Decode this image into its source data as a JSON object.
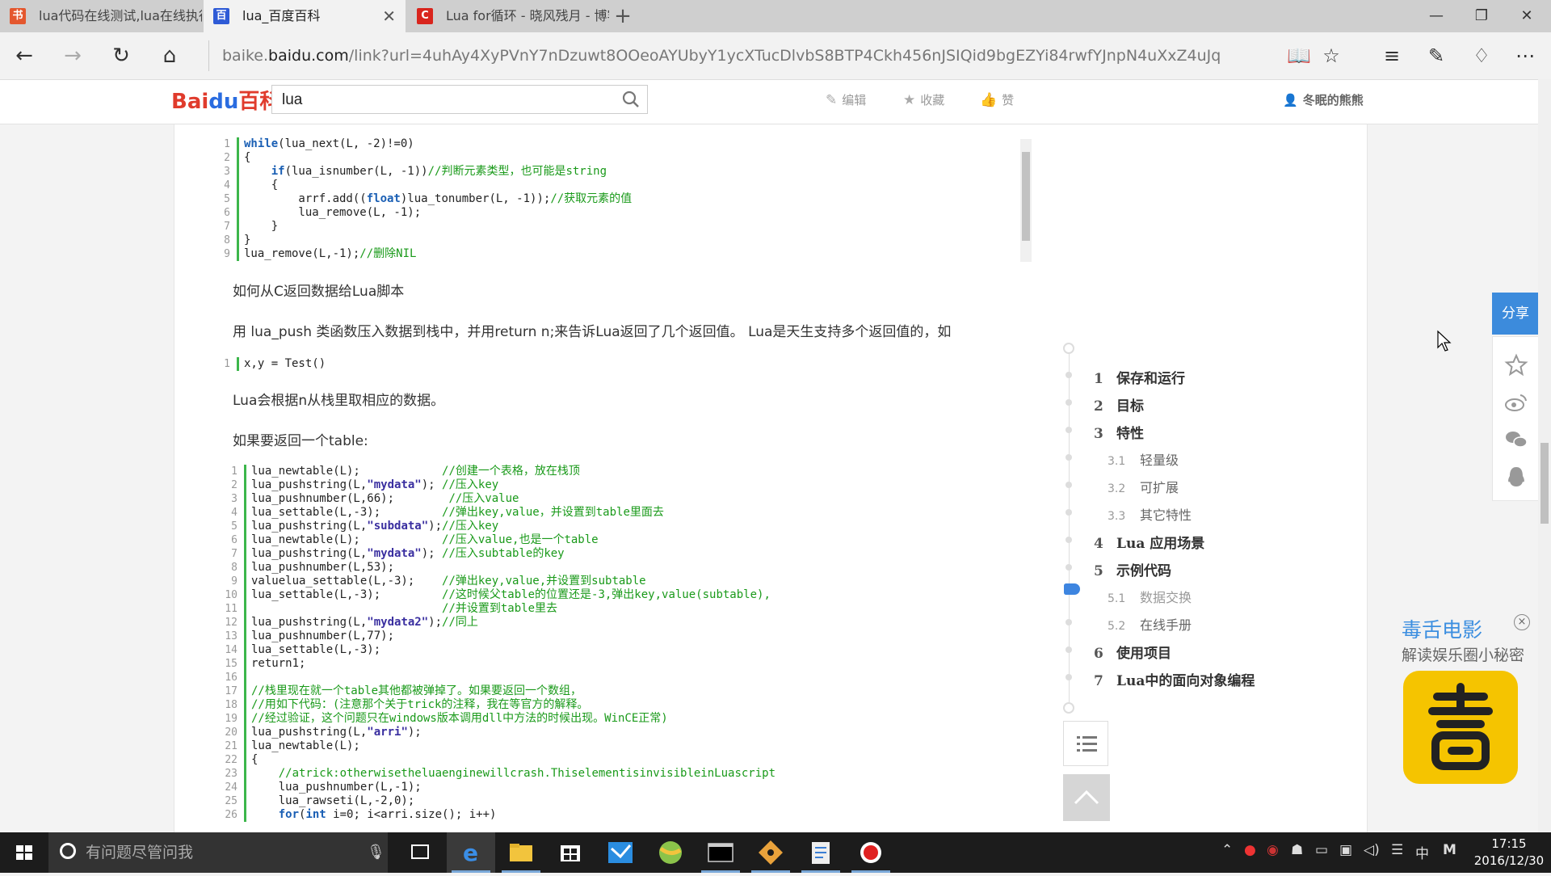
{
  "browser": {
    "tabs": [
      {
        "title": "lua代码在线测试,lua在线执行",
        "favicon": "书",
        "color": "#e4572e"
      },
      {
        "title": "lua_百度百科",
        "favicon": "百",
        "color": "#2f5bd6"
      },
      {
        "title": "Lua for循环 - 晓风残月 - 博客",
        "favicon": "C",
        "color": "#d9251d"
      }
    ],
    "new_tab": "+",
    "url_prefix": "baike.",
    "url_domain": "baidu.com",
    "url_rest": "/link?url=4uhAy4XyPVnY7nDzuwt8OOeoAYUbyY1ycXTucDlvbS8BTP4Ckh456nJSIQid9bgEZYi84rwfYJnpN4uXxZ4uJq"
  },
  "baike": {
    "logo_a": "Bai",
    "logo_b": "du",
    "logo_c": "百科",
    "search_value": "lua",
    "actions": {
      "edit": "编辑",
      "favorite": "收藏",
      "like": "赞"
    },
    "user": "冬眠的熊熊"
  },
  "code1": [
    {
      "n": "1",
      "h": "<span class=\"kw\">while</span>(lua_next(L, -2)!=0)"
    },
    {
      "n": "2",
      "h": "{"
    },
    {
      "n": "3",
      "h": "    <span class=\"kw\">if</span>(lua_isnumber(L, -1))<span class=\"cm\">//判断元素类型，也可能是string</span>"
    },
    {
      "n": "4",
      "h": "    {"
    },
    {
      "n": "5",
      "h": "        arrf.add((<span class=\"kw\">float</span>)lua_tonumber(L, -1));<span class=\"cm\">//获取元素的值</span>"
    },
    {
      "n": "6",
      "h": "        lua_remove(L, -1);"
    },
    {
      "n": "7",
      "h": "    }"
    },
    {
      "n": "8",
      "h": "}"
    },
    {
      "n": "9",
      "h": "lua_remove(L,-1);<span class=\"cm\">//删除NIL</span>"
    }
  ],
  "para1": "如何从C返回数据给Lua脚本",
  "para2": "用 lua_push 类函数压入数据到栈中，并用return n;来告诉Lua返回了几个返回值。 Lua是天生支持多个返回值的，如",
  "code2": [
    {
      "n": "1",
      "h": "x,y = Test()"
    }
  ],
  "para3": "Lua会根据n从栈里取相应的数据。",
  "para4": "如果要返回一个table:",
  "code3": [
    {
      "n": "1",
      "h": "lua_newtable(L);            <span class=\"cm\">//创建一个表格，放在栈顶</span>"
    },
    {
      "n": "2",
      "h": "lua_pushstring(L,<span class=\"st\">\"mydata\"</span>); <span class=\"cm\">//压入key</span>"
    },
    {
      "n": "3",
      "h": "lua_pushnumber(L,66);        <span class=\"cm\">//压入value</span>"
    },
    {
      "n": "4",
      "h": "lua_settable(L,-3);         <span class=\"cm\">//弹出key,value，并设置到table里面去</span>"
    },
    {
      "n": "5",
      "h": "lua_pushstring(L,<span class=\"st\">\"subdata\"</span>);<span class=\"cm\">//压入key</span>"
    },
    {
      "n": "6",
      "h": "lua_newtable(L);            <span class=\"cm\">//压入value,也是一个table</span>"
    },
    {
      "n": "7",
      "h": "lua_pushstring(L,<span class=\"st\">\"mydata\"</span>); <span class=\"cm\">//压入subtable的key</span>"
    },
    {
      "n": "8",
      "h": "lua_pushnumber(L,53);"
    },
    {
      "n": "9",
      "h": "valuelua_settable(L,-3);    <span class=\"cm\">//弹出key,value,并设置到subtable</span>"
    },
    {
      "n": "10",
      "h": "lua_settable(L,-3);         <span class=\"cm\">//这时候父table的位置还是-3,弹出key,value(subtable),</span>"
    },
    {
      "n": "11",
      "h": "                            <span class=\"cm\">//并设置到table里去</span>"
    },
    {
      "n": "12",
      "h": "lua_pushstring(L,<span class=\"st\">\"mydata2\"</span>);<span class=\"cm\">//同上</span>"
    },
    {
      "n": "13",
      "h": "lua_pushnumber(L,77);"
    },
    {
      "n": "14",
      "h": "lua_settable(L,-3);"
    },
    {
      "n": "15",
      "h": "return1;"
    },
    {
      "n": "16",
      "h": ""
    },
    {
      "n": "17",
      "h": "<span class=\"cm\">//栈里现在就一个table其他都被弹掉了。如果要返回一个数组，</span>"
    },
    {
      "n": "18",
      "h": "<span class=\"cm\">//用如下代码：(注意那个关于trick的注释，我在等官方的解释。</span>"
    },
    {
      "n": "19",
      "h": "<span class=\"cm\">//经过验证，这个问题只在windows版本调用dll中方法的时候出现。WinCE正常)</span>"
    },
    {
      "n": "20",
      "h": "lua_pushstring(L,<span class=\"st\">\"arri\"</span>);"
    },
    {
      "n": "21",
      "h": "lua_newtable(L);"
    },
    {
      "n": "22",
      "h": "{"
    },
    {
      "n": "23",
      "h": "    <span class=\"cm\">//atrick:otherwisetheluaenginewillcrash.ThiselementisinvisibleinLuascript</span>"
    },
    {
      "n": "24",
      "h": "    lua_pushnumber(L,-1);"
    },
    {
      "n": "25",
      "h": "    lua_rawseti(L,-2,0);"
    },
    {
      "n": "26",
      "h": "    <span class=\"kw\">for</span>(<span class=\"kw\">int</span> i=0; i&lt;arri.size(); i++)"
    }
  ],
  "toc": [
    {
      "num": "1",
      "label": "保存和运行",
      "level": 1
    },
    {
      "num": "2",
      "label": "目标",
      "level": 1
    },
    {
      "num": "3",
      "label": "特性",
      "level": 1
    },
    {
      "num": "3.1",
      "label": "轻量级",
      "level": 2
    },
    {
      "num": "3.2",
      "label": "可扩展",
      "level": 2
    },
    {
      "num": "3.3",
      "label": "其它特性",
      "level": 2
    },
    {
      "num": "4",
      "label": "Lua 应用场景",
      "level": 1
    },
    {
      "num": "5",
      "label": "示例代码",
      "level": 1
    },
    {
      "num": "5.1",
      "label": "数据交换",
      "level": 2,
      "active": true
    },
    {
      "num": "5.2",
      "label": "在线手册",
      "level": 2
    },
    {
      "num": "6",
      "label": "使用项目",
      "level": 1
    },
    {
      "num": "7",
      "label": "Lua中的面向对象编程",
      "level": 1
    }
  ],
  "share": {
    "label": "分享"
  },
  "ad": {
    "title": "毒舌电影",
    "subtitle": "解读娱乐圈小秘密",
    "close": "×"
  },
  "taskbar": {
    "search_placeholder": "有问题尽管问我",
    "time": "17:15",
    "date": "2016/12/30",
    "ime": "中",
    "ime2": "M"
  }
}
